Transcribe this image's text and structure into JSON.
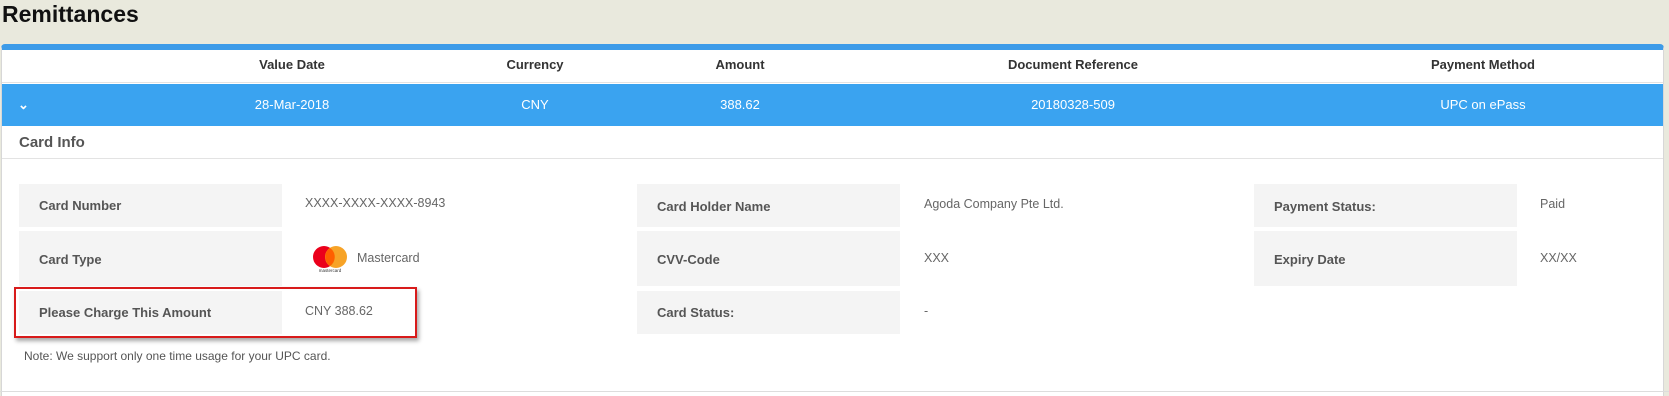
{
  "page": {
    "title": "Remittances"
  },
  "table": {
    "headers": {
      "value_date": "Value Date",
      "currency": "Currency",
      "amount": "Amount",
      "document_reference": "Document Reference",
      "payment_method": "Payment Method"
    },
    "row": {
      "expand_icon": "chevron-down-icon",
      "value_date": "28-Mar-2018",
      "currency": "CNY",
      "amount": "388.62",
      "document_reference": "20180328-509",
      "payment_method": "UPC on ePass"
    }
  },
  "card_info": {
    "title": "Card Info",
    "card_number_label": "Card Number",
    "card_number_value": "XXXX-XXXX-XXXX-8943",
    "card_type_label": "Card Type",
    "card_type_value": "Mastercard",
    "card_type_logo_text": "mastercard",
    "charge_label": "Please Charge This Amount",
    "charge_value": "CNY 388.62",
    "holder_label": "Card Holder Name",
    "holder_value": "Agoda Company Pte Ltd.",
    "cvv_label": "CVV-Code",
    "cvv_value": "XXX",
    "card_status_label": "Card Status:",
    "card_status_value": "-",
    "payment_status_label": "Payment Status:",
    "payment_status_value": "Paid",
    "expiry_label": "Expiry Date",
    "expiry_value": "XX/XX",
    "note": "Note: We support only one time usage for your UPC card."
  },
  "colors": {
    "accent_blue": "#3aa3f0",
    "highlight_red": "#d81b1b",
    "mastercard_red": "#eb001b",
    "mastercard_orange": "#f79e1b"
  }
}
